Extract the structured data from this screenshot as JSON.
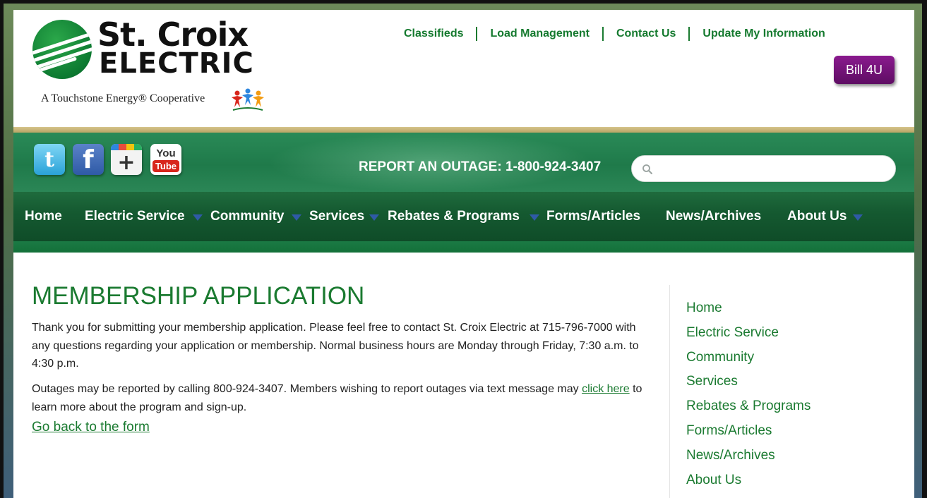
{
  "logo": {
    "name_line1": "St. Croix",
    "name_line2": "ELECTRIC",
    "tagline": "A Touchstone Energy® Cooperative"
  },
  "top_links": [
    {
      "label": "Classifieds"
    },
    {
      "label": "Load Management"
    },
    {
      "label": "Contact Us"
    },
    {
      "label": "Update My Information"
    }
  ],
  "bill_button": {
    "label": "Bill 4U",
    "color": "#6e1473"
  },
  "social": {
    "twitter": {
      "glyph": "t",
      "icon": "twitter-icon"
    },
    "facebook": {
      "glyph": "f",
      "icon": "facebook-icon"
    },
    "google_plus": {
      "glyph": "+",
      "icon": "google-plus-icon"
    },
    "youtube": {
      "you": "You",
      "tube": "Tube",
      "icon": "youtube-icon"
    }
  },
  "outage": {
    "text": "REPORT AN OUTAGE: 1-800-924-3407"
  },
  "search": {
    "placeholder": "",
    "value": ""
  },
  "nav": [
    {
      "label": "Home",
      "has_dropdown": false
    },
    {
      "label": "Electric Service",
      "has_dropdown": true
    },
    {
      "label": "Community",
      "has_dropdown": true
    },
    {
      "label": "Services",
      "has_dropdown": true
    },
    {
      "label": "Rebates & Programs",
      "has_dropdown": true
    },
    {
      "label": "Forms/Articles",
      "has_dropdown": false
    },
    {
      "label": "News/Archives",
      "has_dropdown": false
    },
    {
      "label": "About Us",
      "has_dropdown": true
    }
  ],
  "main": {
    "title": "MEMBERSHIP APPLICATION",
    "para1": "Thank you for submitting your membership application. Please feel free to contact St. Croix Electric at 715-796-7000 with any questions regarding your application or membership. Normal business hours are Monday through Friday, 7:30 a.m. to 4:30 p.m.",
    "para2_before": "Outages may be reported by calling 800-924-3407. Members wishing to report outages via text message may ",
    "para2_link": "click here",
    "para2_after": " to learn more about the program and sign-up.",
    "go_back": "Go back to the form"
  },
  "sidenav": [
    {
      "label": "Home"
    },
    {
      "label": "Electric Service"
    },
    {
      "label": "Community"
    },
    {
      "label": "Services"
    },
    {
      "label": "Rebates & Programs"
    },
    {
      "label": "Forms/Articles"
    },
    {
      "label": "News/Archives"
    },
    {
      "label": "About Us"
    }
  ],
  "colors": {
    "brand_green": "#1a7a30",
    "nav_dark_green": "#0f4c28",
    "gold": "#c9b574",
    "arrow_blue": "#2f5aa6"
  }
}
